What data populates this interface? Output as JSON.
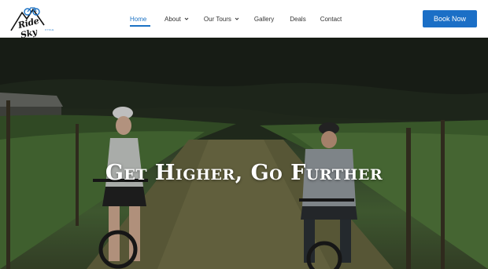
{
  "header": {
    "logo_text": "Ride Sky",
    "logo_subtext": "CYCLE",
    "nav": [
      {
        "label": "Home",
        "active": true,
        "has_dropdown": false
      },
      {
        "label": "About",
        "active": false,
        "has_dropdown": true
      },
      {
        "label": "Our Tours",
        "active": false,
        "has_dropdown": true
      },
      {
        "label": "Gallery",
        "active": false,
        "has_dropdown": false
      },
      {
        "label": "Deals",
        "active": false,
        "has_dropdown": false
      },
      {
        "label": "Contact",
        "active": false,
        "has_dropdown": false
      }
    ],
    "book_button": "Book Now"
  },
  "hero": {
    "title": "Get Higher, Go Further",
    "image_subject": "two-cyclists-riding-through-vineyard"
  },
  "colors": {
    "accent": "#1b72c4",
    "button": "#1b6fc6",
    "header_bg": "#ffffff"
  }
}
